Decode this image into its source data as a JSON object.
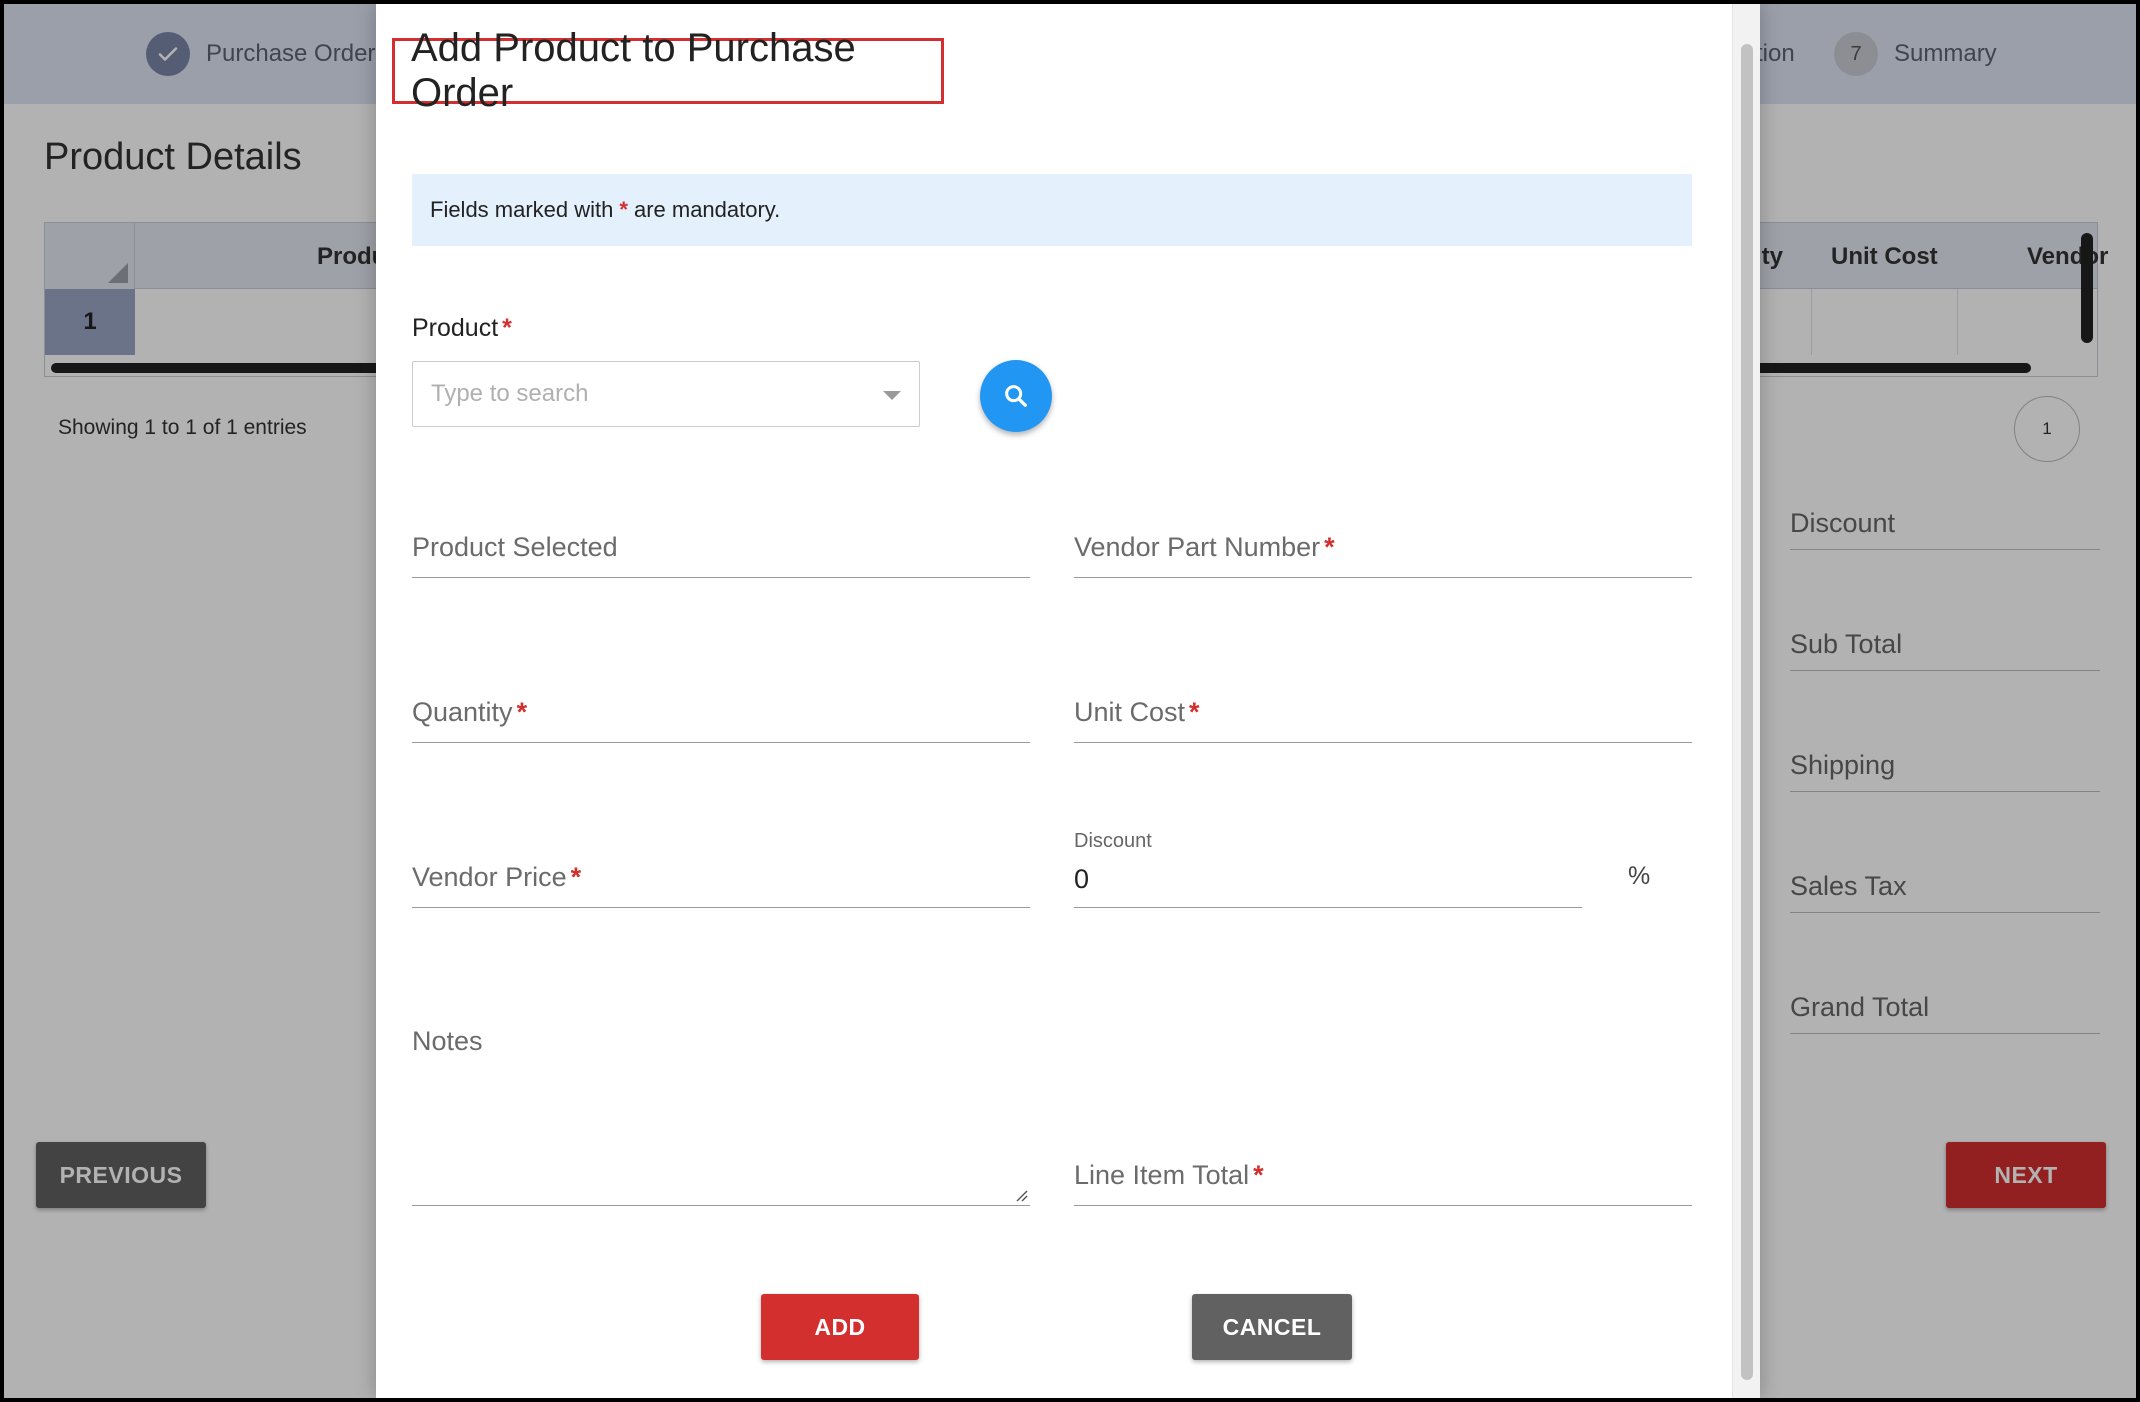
{
  "stepper": {
    "step1": {
      "label": "Purchase Order I"
    },
    "step6": {
      "label": "tion"
    },
    "step7": {
      "number": "7",
      "label": "Summary"
    }
  },
  "background": {
    "title": "Product Details",
    "grid": {
      "headers": {
        "product": "Produ",
        "quantity": "ity",
        "unit_cost": "Unit Cost",
        "vendor": "Vendor"
      },
      "row_number": "1"
    },
    "showing_text": "Showing 1 to 1 of 1 entries",
    "page_number": "1",
    "totals": {
      "discount": "Discount",
      "sub_total": "Sub Total",
      "shipping": "Shipping",
      "sales_tax": "Sales Tax",
      "grand_total": "Grand Total"
    },
    "previous_label": "PREVIOUS",
    "next_label": "NEXT"
  },
  "modal": {
    "title": "Add Product to Purchase Order",
    "notice": {
      "prefix": "Fields marked with",
      "star": "*",
      "suffix": "are mandatory."
    },
    "product": {
      "label": "Product",
      "placeholder": "Type to search"
    },
    "fields": {
      "product_selected": "Product Selected",
      "vendor_part_number": "Vendor Part Number",
      "quantity": "Quantity",
      "unit_cost": "Unit Cost",
      "vendor_price": "Vendor Price",
      "discount_label": "Discount",
      "discount_value": "0",
      "discount_unit": "%",
      "notes": "Notes",
      "line_item_total": "Line Item Total"
    },
    "required_marker": "*",
    "add_label": "ADD",
    "cancel_label": "CANCEL"
  },
  "colors": {
    "accent_red": "#d32f2f",
    "search_blue": "#2196f3",
    "cancel_gray": "#616161",
    "notice_bg": "#e4f1fc"
  }
}
